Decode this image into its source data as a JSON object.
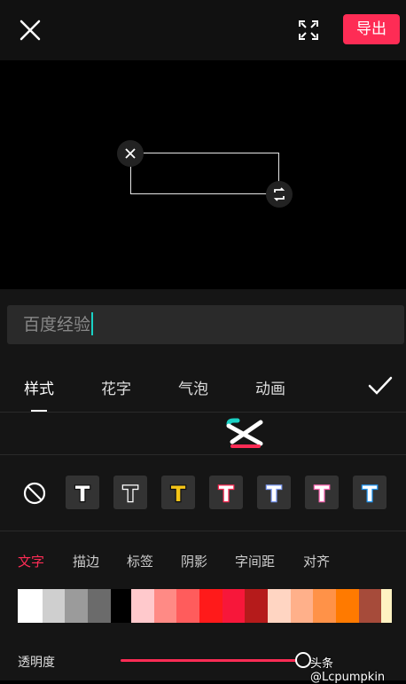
{
  "topbar": {
    "close_icon": "close-icon",
    "fullscreen_icon": "fullscreen-icon",
    "export_label": "导出",
    "accent": "#fe2c55"
  },
  "preview": {
    "textbox_close_icon": "close-icon",
    "textbox_rotate_icon": "rotate-scale-icon"
  },
  "editor": {
    "text_value": "百度经验"
  },
  "tabs": [
    {
      "label": "样式",
      "active": true
    },
    {
      "label": "花字",
      "active": false
    },
    {
      "label": "气泡",
      "active": false
    },
    {
      "label": "动画",
      "active": false
    }
  ],
  "confirm_icon": "check-icon",
  "styles": [
    {
      "icon": "none-icon"
    },
    {
      "letter": "T",
      "fill": "#ffffff",
      "stroke": "#111111"
    },
    {
      "letter": "T",
      "fill": "#333333",
      "stroke": "#ffffff"
    },
    {
      "letter": "T",
      "fill": "#f5c518",
      "stroke": "#111111"
    },
    {
      "letter": "T",
      "fill": "#ffffff",
      "stroke": "#fe2c55"
    },
    {
      "letter": "T",
      "fill": "#ffffff",
      "stroke": "#7f9cf5"
    },
    {
      "letter": "T",
      "fill": "#ffffff",
      "stroke": "#ff69b4"
    },
    {
      "letter": "T",
      "fill": "#ffffff",
      "stroke": "#2196f3"
    }
  ],
  "subtabs": [
    {
      "label": "文字",
      "active": true
    },
    {
      "label": "描边",
      "active": false
    },
    {
      "label": "标签",
      "active": false
    },
    {
      "label": "阴影",
      "active": false
    },
    {
      "label": "字间距",
      "active": false
    },
    {
      "label": "对齐",
      "active": false
    }
  ],
  "palette": [
    "#ffffff",
    "#cfcfcf",
    "#9b9b9b",
    "#6b6b6b",
    "#000000",
    "#ffc9cc",
    "#ff8a85",
    "#ff5c5c",
    "#ff1a1a",
    "#f7173a",
    "#b51b1b",
    "#ffd5c2",
    "#ffb08a",
    "#ff9248",
    "#ff7a00",
    "#a64b3a",
    "#fff2c2"
  ],
  "opacity": {
    "label": "透明度",
    "value": 0.98
  },
  "watermark": "头条 @Lcpumpkin"
}
